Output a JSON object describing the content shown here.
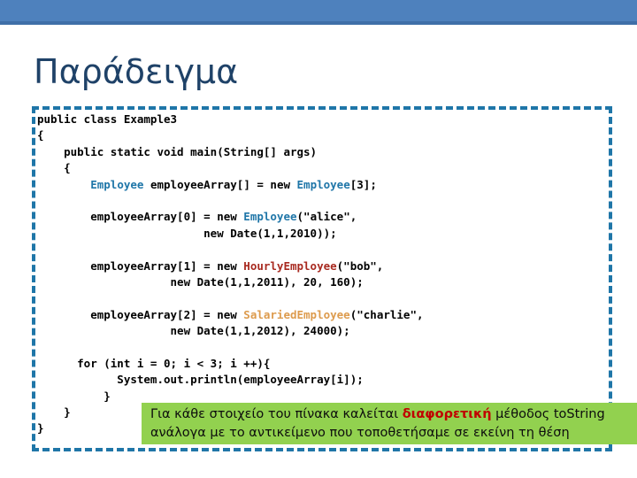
{
  "slide": {
    "title": "Παράδειγμα",
    "accent_bar_color": "#4E81BD",
    "accent_bar_shadow_color": "#3F6FA8",
    "title_color": "#1F4268",
    "code_border_color": "#1F76A8",
    "callout_bg_color": "#92D14F",
    "callout_emphasis_color": "#C00000"
  },
  "code": {
    "language": "java",
    "lines": [
      {
        "id": "l1",
        "parts": [
          {
            "text": "public class Example3",
            "style": "plain"
          }
        ]
      },
      {
        "id": "l2",
        "parts": [
          {
            "text": "{",
            "style": "plain"
          }
        ]
      },
      {
        "id": "l3",
        "parts": [
          {
            "text": "    public static void main(String[] args)",
            "style": "plain"
          }
        ]
      },
      {
        "id": "l4",
        "parts": [
          {
            "text": "    {",
            "style": "plain"
          }
        ]
      },
      {
        "id": "l5",
        "parts": [
          {
            "text": "        ",
            "style": "plain"
          },
          {
            "text": "Employee",
            "style": "type-blue"
          },
          {
            "text": " employeeArray[] = new ",
            "style": "plain"
          },
          {
            "text": "Employee",
            "style": "type-blue"
          },
          {
            "text": "[3];",
            "style": "plain"
          }
        ]
      },
      {
        "id": "l6",
        "parts": [
          {
            "text": "",
            "style": "plain"
          }
        ]
      },
      {
        "id": "l7",
        "parts": [
          {
            "text": "        employeeArray[0] = new ",
            "style": "plain"
          },
          {
            "text": "Employee",
            "style": "type-blue"
          },
          {
            "text": "(\"alice\",",
            "style": "plain"
          }
        ]
      },
      {
        "id": "l8",
        "parts": [
          {
            "text": "                         new Date(1,1,2010));",
            "style": "plain"
          }
        ]
      },
      {
        "id": "l9",
        "parts": [
          {
            "text": "",
            "style": "plain"
          }
        ]
      },
      {
        "id": "l10",
        "parts": [
          {
            "text": "        employeeArray[1] = new ",
            "style": "plain"
          },
          {
            "text": "HourlyEmployee",
            "style": "type-red"
          },
          {
            "text": "(\"bob\",",
            "style": "plain"
          }
        ]
      },
      {
        "id": "l11",
        "parts": [
          {
            "text": "                    new Date(1,1,2011), 20, 160);",
            "style": "plain"
          }
        ]
      },
      {
        "id": "l12",
        "parts": [
          {
            "text": "",
            "style": "plain"
          }
        ]
      },
      {
        "id": "l13",
        "parts": [
          {
            "text": "        employeeArray[2] = new ",
            "style": "plain"
          },
          {
            "text": "SalariedEmployee",
            "style": "type-orange"
          },
          {
            "text": "(\"charlie\",",
            "style": "plain"
          }
        ]
      },
      {
        "id": "l14",
        "parts": [
          {
            "text": "                    new Date(1,1,2012), 24000);",
            "style": "plain"
          }
        ]
      },
      {
        "id": "l15",
        "parts": [
          {
            "text": "",
            "style": "plain"
          }
        ]
      },
      {
        "id": "l16",
        "parts": [
          {
            "text": "      for (int i = 0; i < 3; i ++){",
            "style": "plain"
          }
        ]
      },
      {
        "id": "l17",
        "parts": [
          {
            "text": "            System.out.println(employeeArray[i]);",
            "style": "plain"
          }
        ]
      },
      {
        "id": "l18",
        "parts": [
          {
            "text": "          }",
            "style": "plain"
          }
        ]
      },
      {
        "id": "l19",
        "parts": [
          {
            "text": "    }",
            "style": "plain"
          }
        ]
      },
      {
        "id": "l20",
        "parts": [
          {
            "text": "}",
            "style": "plain"
          }
        ]
      }
    ]
  },
  "callout": {
    "line1_before": "Για κάθε στοιχείο του πίνακα καλείται ",
    "line1_emphasis": "διαφορετική",
    "line1_after": " μέθοδος toString",
    "line2": "ανάλογα με το αντικείμενο που τοποθετήσαμε σε εκείνη τη θέση"
  }
}
